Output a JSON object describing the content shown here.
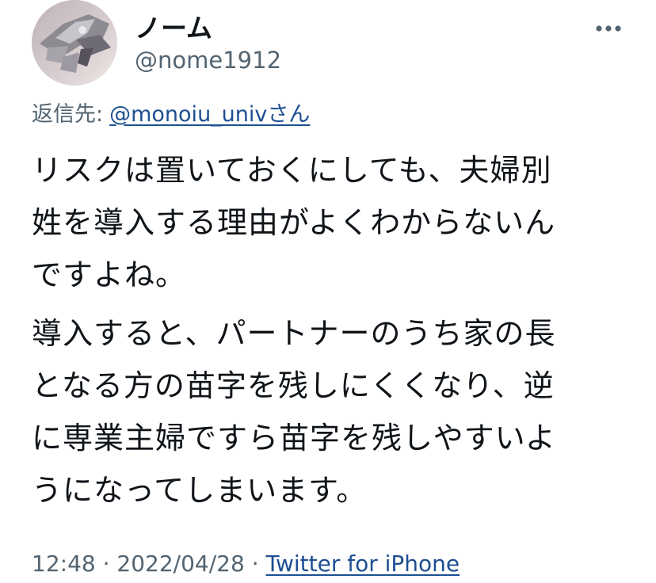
{
  "user": {
    "display_name": "ノーム",
    "handle": "@nome1912",
    "avatar_icon": "robot-mecha-avatar"
  },
  "more_icon": "more-horizontal-icon",
  "reply": {
    "prefix": "返信先:",
    "mention": "@monoiu_univ",
    "suffix": "さん"
  },
  "tweet": {
    "paragraph1_lines": [
      "リスクは置いておくにしても、夫婦別",
      "姓を導入する理由がよくわからないん",
      "ですよね。"
    ],
    "paragraph2_lines": [
      "導入すると、パートナーのうち家の長",
      "となる方の苗字を残しにくくなり、逆",
      "に専業主婦ですら苗字を残しやすいよ",
      "うになってしまいます。"
    ]
  },
  "meta": {
    "time": "12:48",
    "sep1": " · ",
    "date": "2022/04/28",
    "sep2": " · ",
    "source": "Twitter for iPhone"
  },
  "colors": {
    "text": "#0f1419",
    "secondary": "#536471",
    "link": "#1d4f91"
  }
}
